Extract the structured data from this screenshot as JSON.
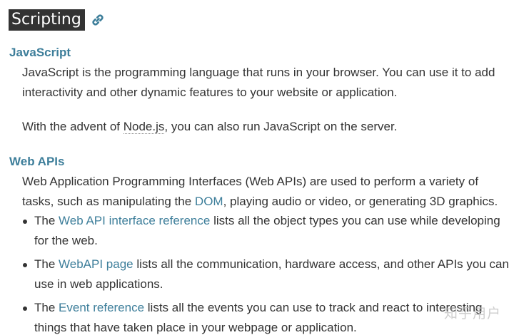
{
  "section": {
    "title": "Scripting",
    "link_icon": "link-icon"
  },
  "javascript": {
    "term": "JavaScript",
    "para1": "JavaScript is the programming language that runs in your browser. You can use it to add interactivity and other dynamic features to your website or application.",
    "para2_before": "With the advent of ",
    "para2_code": "Node.js",
    "para2_after": ", you can also run JavaScript on the server."
  },
  "webapis": {
    "term": "Web APIs",
    "para_before": "Web Application Programming Interfaces (Web APIs) are used to perform a variety of tasks, such as manipulating the ",
    "para_link": "DOM",
    "para_after": ", playing audio or video, or generating 3D graphics.",
    "items": [
      {
        "before": "The ",
        "link": "Web API interface reference",
        "after": " lists all the object types you can use while developing for the web."
      },
      {
        "before": "The ",
        "link": "WebAPI page",
        "after": " lists all the communication, hardware access, and other APIs you can use in web applications."
      },
      {
        "before": "The ",
        "link": "Event reference",
        "after": " lists all the events you can use to track and react to interesting things that have taken place in your webpage or application."
      }
    ]
  },
  "watermark": "知乎用户",
  "colors": {
    "link": "#3d7e9a",
    "text": "#333333",
    "title_bg": "#333333"
  }
}
